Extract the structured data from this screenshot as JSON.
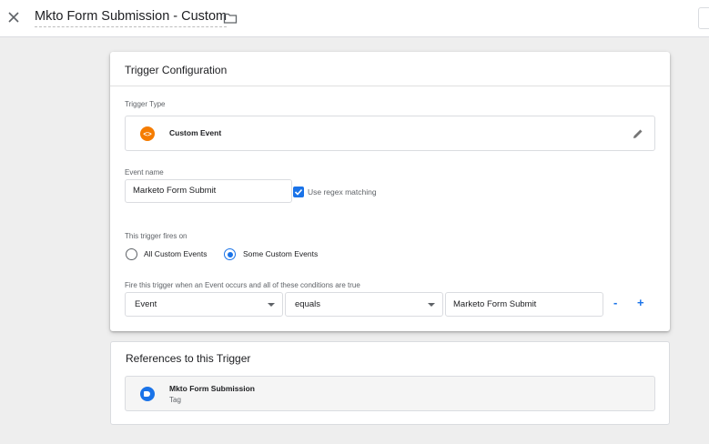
{
  "header": {
    "title": "Mkto Form Submission - Custom"
  },
  "config": {
    "title": "Trigger Configuration",
    "trigger_type_label": "Trigger Type",
    "trigger_type_value": "Custom Event",
    "event_name_label": "Event name",
    "event_name_value": "Marketo Form Submit",
    "regex_label": "Use regex matching",
    "regex_checked": true,
    "fires_on_label": "This trigger fires on",
    "fires_on_options": [
      "All Custom Events",
      "Some Custom Events"
    ],
    "fires_on_selected": "Some Custom Events",
    "conditions_label": "Fire this trigger when an Event occurs and all of these conditions are true",
    "condition": {
      "variable": "Event",
      "operator": "equals",
      "value": "Marketo Form Submit"
    },
    "remove_label": "-",
    "add_label": "+"
  },
  "references": {
    "title": "References to this Trigger",
    "items": [
      {
        "name": "Mkto Form Submission",
        "type": "Tag"
      }
    ]
  },
  "colors": {
    "accent": "#1a73e8",
    "custom_event_icon": "#f57c00"
  },
  "icons": [
    "close-icon",
    "folder-icon",
    "custom-event-icon",
    "pencil-icon",
    "check-icon",
    "chevron-down-icon",
    "tag-icon"
  ]
}
